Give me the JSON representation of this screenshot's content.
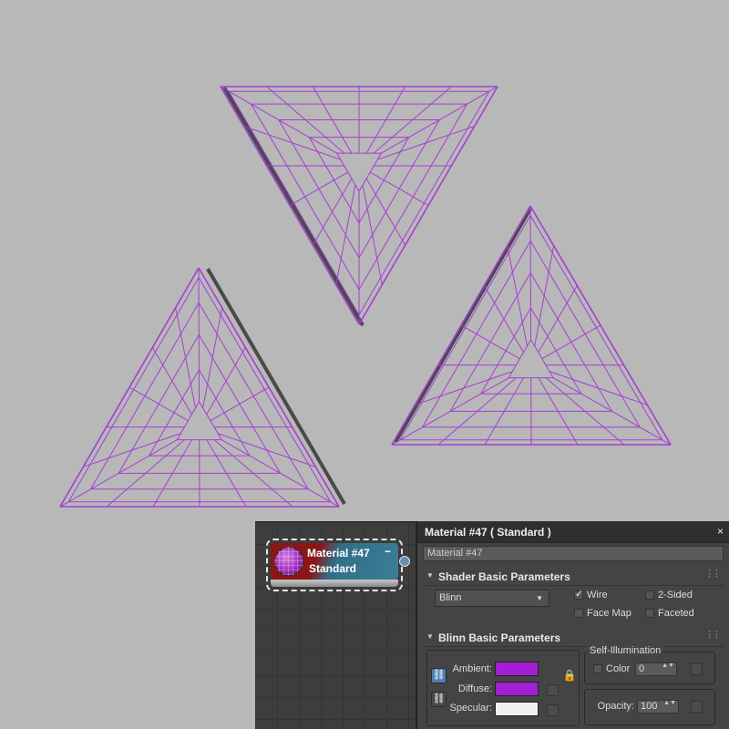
{
  "node": {
    "title": "Material #47",
    "type": "Standard",
    "minus": "−"
  },
  "panel": {
    "title": "Material #47  ( Standard )",
    "close": "×",
    "name_value": "Material #47",
    "shader_rollout": "Shader Basic Parameters",
    "shader_value": "Blinn",
    "wire": "Wire",
    "two_sided": "2-Sided",
    "face_map": "Face Map",
    "faceted": "Faceted",
    "blinn_rollout": "Blinn Basic Parameters",
    "self_illum_group": "Self-Illumination",
    "color_label": "Color",
    "color_value": "0",
    "ambient": "Ambient:",
    "diffuse": "Diffuse:",
    "specular": "Specular:",
    "opacity": "Opacity:",
    "opacity_value": "100"
  },
  "icons": {
    "rollout_arrow": "▼",
    "dropdown_chevron": "▼",
    "checkmark": "✓",
    "spinner": "▲▼",
    "lock": "🔒",
    "link": "⛓"
  },
  "colors": {
    "wire": "#a43fd2",
    "ambient": "#a21fd6",
    "diffuse": "#a21fd6",
    "specular": "#f0f0f0"
  }
}
